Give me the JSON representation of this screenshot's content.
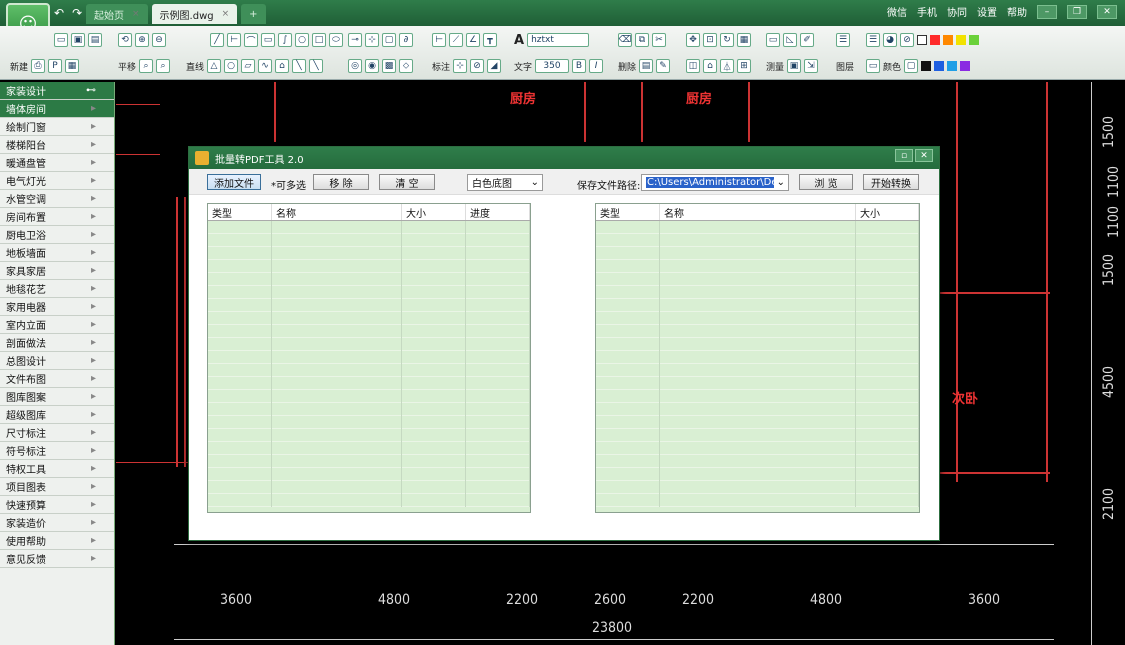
{
  "window": {
    "tabs": [
      {
        "label": "起始页",
        "active": false
      },
      {
        "label": "示例图.dwg",
        "active": true
      }
    ],
    "add_tab": "+",
    "right_links": [
      "微信",
      "手机",
      "协同",
      "设置",
      "帮助"
    ]
  },
  "toolbar": {
    "new_label": "新建",
    "pan_label": "平移",
    "line_label": "直线",
    "dim_label": "标注",
    "text_label": "文字",
    "font_value": "hztxt",
    "size_value": "350",
    "bold": "B",
    "italic": "I",
    "delete_label": "删除",
    "measure_label": "测量",
    "layer_label": "图层",
    "color_label": "颜色",
    "colors": [
      "#ffffff",
      "#ff2a2a",
      "#ff8800",
      "#f2e200",
      "#6ad13a",
      "#111111",
      "#1e5fe0",
      "#1f9fe6",
      "#8a2be2"
    ]
  },
  "sidebar": {
    "header": "家装设计",
    "items": [
      "墙体房间",
      "绘制门窗",
      "楼梯阳台",
      "暖通盘管",
      "电气灯光",
      "水管空调",
      "房间布置",
      "厨电卫浴",
      "地板墙面",
      "家具家居",
      "地毯花艺",
      "家用电器",
      "室内立面",
      "剖面做法",
      "总图设计",
      "文件布图",
      "图库图案",
      "超级图库",
      "尺寸标注",
      "符号标注",
      "特权工具",
      "项目图表",
      "快速预算",
      "家装造价",
      "使用帮助",
      "意见反馈"
    ]
  },
  "drawing": {
    "rooms": [
      "厨房",
      "厨房",
      "次卧"
    ],
    "right_dims": [
      "1500",
      "1100",
      "1100",
      "1500",
      "4500",
      "2100"
    ],
    "bottom_dims": [
      "3600",
      "4800",
      "2200",
      "2600",
      "2200",
      "4800",
      "3600"
    ],
    "total_dim": "23800"
  },
  "dialog": {
    "title": "批量转PDF工具 2.0",
    "add_file": "添加文件",
    "multi_hint": "*可多选",
    "remove": "移 除",
    "clear": "清 空",
    "bg_select": "白色底图",
    "save_path_label": "保存文件路径:",
    "save_path_value": "C:\\Users\\Administrator\\Desk",
    "browse": "浏 览",
    "start": "开始转换",
    "left_columns": [
      "类型",
      "名称",
      "大小",
      "进度"
    ],
    "right_columns": [
      "类型",
      "名称",
      "大小"
    ]
  }
}
